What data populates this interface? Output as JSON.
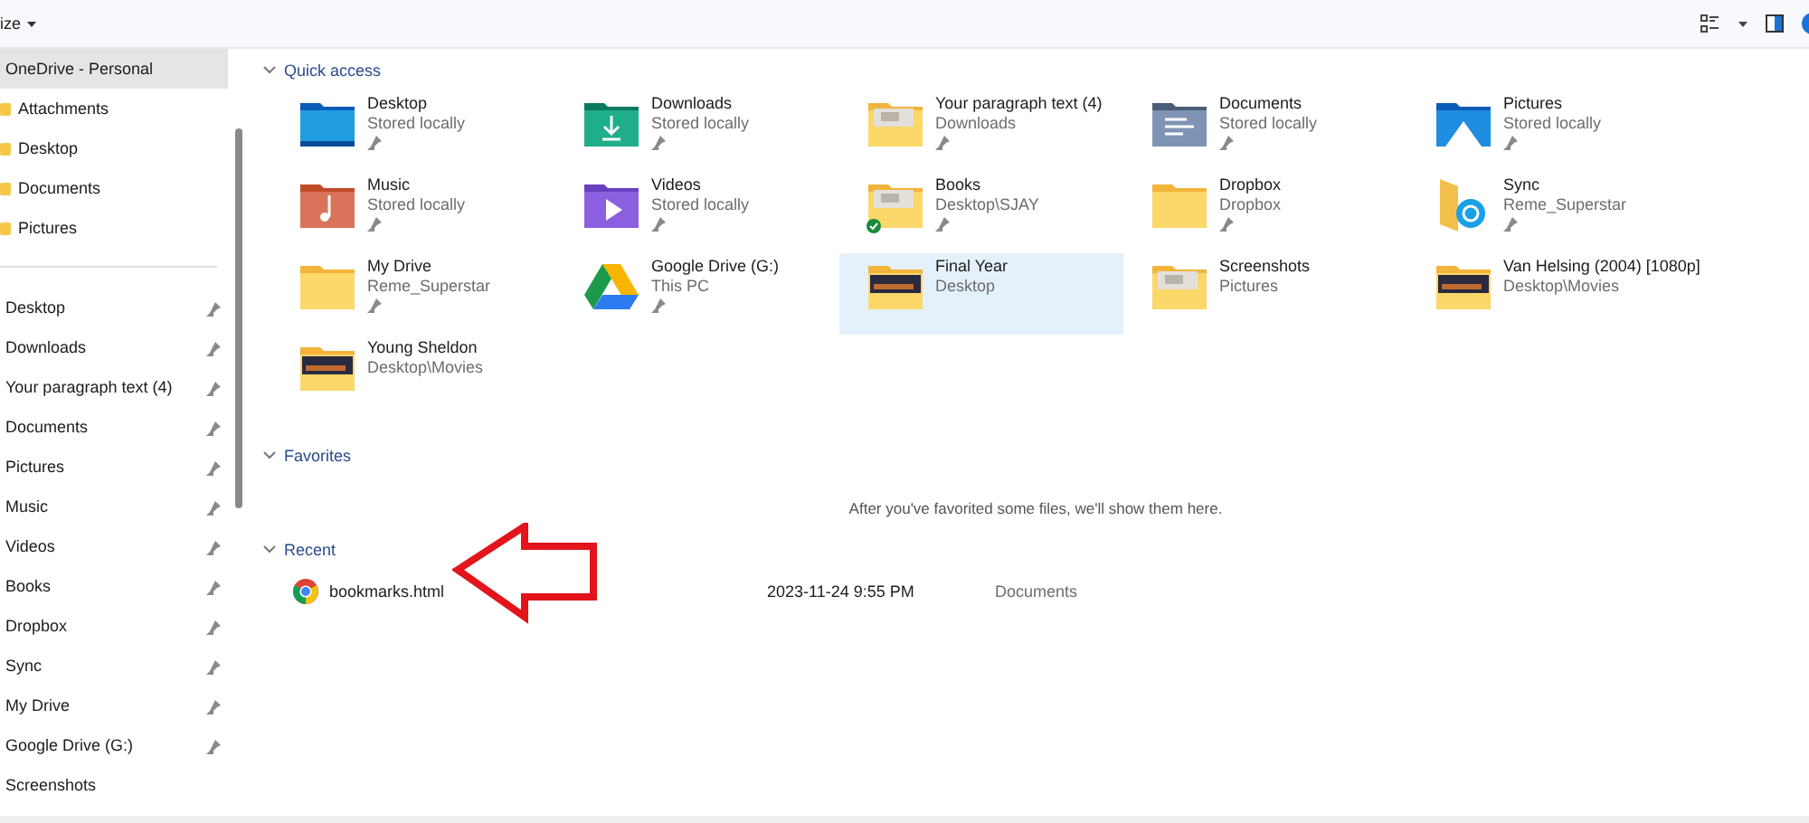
{
  "toolbar": {
    "menu_label": "ize"
  },
  "sidebar": {
    "groups": [
      [
        {
          "label": "OneDrive - Personal",
          "selected": true,
          "kind": "root"
        },
        {
          "label": "Attachments",
          "selected": false,
          "kind": "folder"
        },
        {
          "label": "Desktop",
          "selected": false,
          "kind": "folder"
        },
        {
          "label": "Documents",
          "selected": false,
          "kind": "folder"
        },
        {
          "label": "Pictures",
          "selected": false,
          "kind": "folder"
        }
      ],
      [
        {
          "label": "Desktop",
          "selected": false,
          "pinned": true,
          "kind": "plain"
        },
        {
          "label": "Downloads",
          "selected": false,
          "pinned": true,
          "kind": "plain"
        },
        {
          "label": "Your paragraph text (4)",
          "selected": false,
          "pinned": true,
          "kind": "plain"
        },
        {
          "label": "Documents",
          "selected": false,
          "pinned": true,
          "kind": "plain"
        },
        {
          "label": "Pictures",
          "selected": false,
          "pinned": true,
          "kind": "plain"
        },
        {
          "label": "Music",
          "selected": false,
          "pinned": true,
          "kind": "plain"
        },
        {
          "label": "Videos",
          "selected": false,
          "pinned": true,
          "kind": "plain"
        },
        {
          "label": "Books",
          "selected": false,
          "pinned": true,
          "kind": "plain"
        },
        {
          "label": "Dropbox",
          "selected": false,
          "pinned": true,
          "kind": "plain"
        },
        {
          "label": "Sync",
          "selected": false,
          "pinned": true,
          "kind": "plain"
        },
        {
          "label": "My Drive",
          "selected": false,
          "pinned": true,
          "kind": "plain"
        },
        {
          "label": "Google Drive (G:)",
          "selected": false,
          "pinned": true,
          "kind": "plain"
        },
        {
          "label": "Screenshots",
          "selected": false,
          "pinned": false,
          "kind": "plain"
        }
      ]
    ]
  },
  "quick_access": {
    "title": "Quick access",
    "expanded": true,
    "items": [
      {
        "name": "Desktop",
        "location": "Stored locally",
        "pinned": true,
        "selected": false,
        "synced": false,
        "kind": "desktop"
      },
      {
        "name": "Downloads",
        "location": "Stored locally",
        "pinned": true,
        "selected": false,
        "synced": false,
        "kind": "downloads"
      },
      {
        "name": "Your paragraph text (4)",
        "location": "Downloads",
        "pinned": true,
        "selected": false,
        "synced": false,
        "kind": "thumb-light"
      },
      {
        "name": "Documents",
        "location": "Stored locally",
        "pinned": true,
        "selected": false,
        "synced": false,
        "kind": "documents"
      },
      {
        "name": "Pictures",
        "location": "Stored locally",
        "pinned": true,
        "selected": false,
        "synced": false,
        "kind": "pictures"
      },
      {
        "name": "Music",
        "location": "Stored locally",
        "pinned": true,
        "selected": false,
        "synced": false,
        "kind": "music"
      },
      {
        "name": "Videos",
        "location": "Stored locally",
        "pinned": true,
        "selected": false,
        "synced": false,
        "kind": "videos"
      },
      {
        "name": "Books",
        "location": "Desktop\\SJAY",
        "pinned": true,
        "selected": false,
        "synced": true,
        "kind": "thumb-light"
      },
      {
        "name": "Dropbox",
        "location": "Dropbox",
        "pinned": true,
        "selected": false,
        "synced": false,
        "kind": "folder"
      },
      {
        "name": "Sync",
        "location": "Reme_Superstar",
        "pinned": true,
        "selected": false,
        "synced": false,
        "kind": "sync"
      },
      {
        "name": "My Drive",
        "location": "Reme_Superstar",
        "pinned": true,
        "selected": false,
        "synced": false,
        "kind": "folder"
      },
      {
        "name": "Google Drive (G:)",
        "location": "This PC",
        "pinned": true,
        "selected": false,
        "synced": false,
        "kind": "drive"
      },
      {
        "name": "Final Year",
        "location": "Desktop",
        "pinned": false,
        "selected": true,
        "synced": false,
        "kind": "thumb-dark"
      },
      {
        "name": "Screenshots",
        "location": "Pictures",
        "pinned": false,
        "selected": false,
        "synced": false,
        "kind": "thumb-light"
      },
      {
        "name": "Van Helsing (2004) [1080p]",
        "location": "Desktop\\Movies",
        "pinned": false,
        "selected": false,
        "synced": false,
        "kind": "thumb-dark"
      },
      {
        "name": "Young Sheldon",
        "location": "Desktop\\Movies",
        "pinned": false,
        "selected": false,
        "synced": false,
        "kind": "thumb-dark"
      }
    ]
  },
  "favorites": {
    "title": "Favorites",
    "expanded": true,
    "empty_message": "After you've favorited some files, we'll show them here."
  },
  "recent": {
    "title": "Recent",
    "expanded": true,
    "files": [
      {
        "name": "bookmarks.html",
        "date": "2023-11-24 9:55 PM",
        "location": "Documents",
        "selected": false
      }
    ]
  },
  "annotation": {
    "kind": "arrow-left"
  }
}
